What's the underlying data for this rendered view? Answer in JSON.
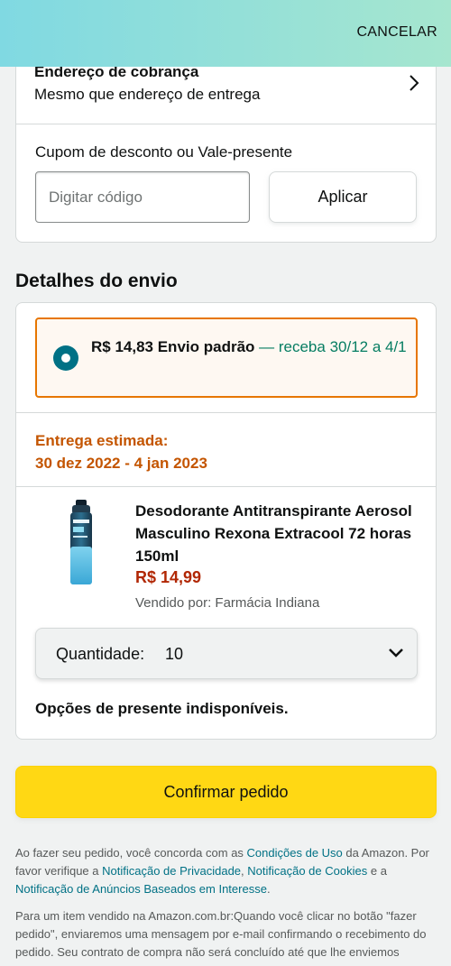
{
  "header": {
    "cancel_label": "CANCELAR"
  },
  "billing": {
    "title": "Endereço de cobrança",
    "subtitle": "Mesmo que endereço de entrega"
  },
  "coupon": {
    "label": "Cupom de desconto ou Vale-presente",
    "placeholder": "Digitar código",
    "value": "",
    "apply_label": "Aplicar"
  },
  "shipping": {
    "section_title": "Detalhes do envio",
    "option": {
      "price_method": "R$ 14,83 Envio padrão",
      "eta": "— receba 30/12 a 4/1",
      "selected": true
    },
    "estimate_label": "Entrega estimada:",
    "estimate_dates": "30 dez 2022 - 4 jan 2023",
    "product": {
      "title": "Desodorante Antitranspirante Aerosol Masculino Rexona Extracool 72 horas 150ml",
      "price": "R$ 14,99",
      "seller": "Vendido por: Farmácia Indiana"
    },
    "quantity_label": "Quantidade:",
    "quantity_value": "10",
    "gift_note": "Opções de presente indisponíveis."
  },
  "confirm_label": "Confirmar pedido",
  "legal": {
    "p1_a": "Ao fazer seu pedido, você concorda com as ",
    "link_terms": "Condições de Uso",
    "p1_b": " da Amazon. Por favor verifique a ",
    "link_privacy": "Notificação de Privacidade",
    "p1_c": ", ",
    "link_cookies": "Notificação de Cookies",
    "p1_d": " e a ",
    "link_ads": "Notificação de Anúncios Baseados em Interesse",
    "p1_e": ".",
    "p2": "Para um item vendido na Amazon.com.br:Quando você clicar no botão \"fazer pedido\", enviaremos uma mensagem por e-mail confirmando o recebimento do pedido. Seu contrato de compra não será concluído até que lhe enviemos"
  },
  "colors": {
    "accent": "#007185",
    "shipping_border": "#e77600",
    "estimate": "#c45500",
    "price": "#b12704",
    "eta": "#067d62",
    "confirm_button": "#ffd814"
  },
  "icons": {
    "billing_arrow": "chevron-right-icon",
    "quantity_arrow": "chevron-down-icon",
    "radio": "radio-selected-icon"
  }
}
